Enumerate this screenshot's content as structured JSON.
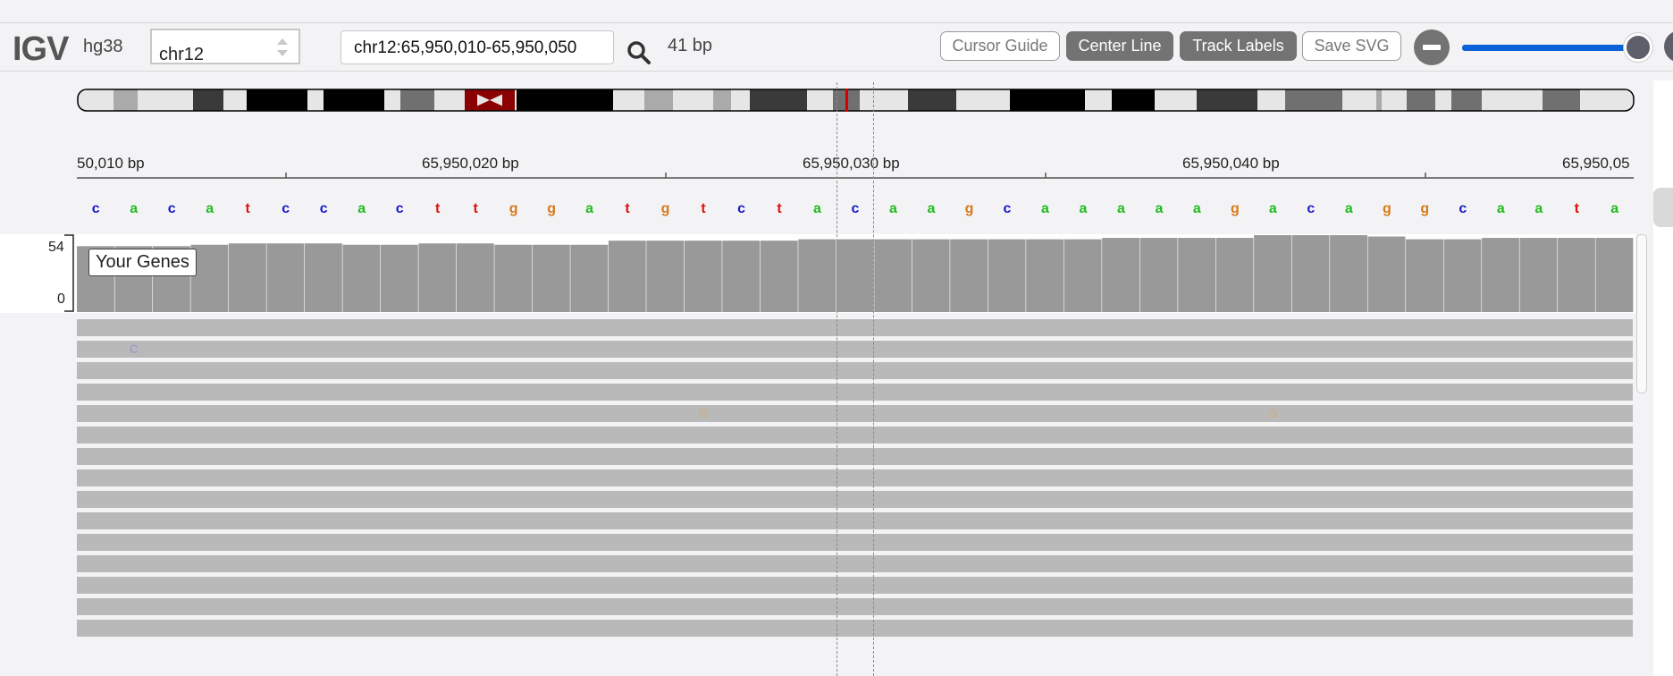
{
  "navbar": {
    "logo": "IGV",
    "genome": "hg38",
    "chromosome": "chr12",
    "locus": "chr12:65,950,010-65,950,050",
    "window_size": "41 bp",
    "buttons": {
      "cursor_guide": "Cursor Guide",
      "center_line": "Center Line",
      "track_labels": "Track Labels",
      "save_svg": "Save SVG"
    },
    "zoom_level": 1.0
  },
  "ruler": {
    "ticks": [
      "50,010 bp",
      "65,950,020 bp",
      "65,950,030 bp",
      "65,950,040 bp",
      "65,950,05"
    ]
  },
  "sequence": [
    "c",
    "a",
    "c",
    "a",
    "t",
    "c",
    "c",
    "a",
    "c",
    "t",
    "t",
    "g",
    "g",
    "a",
    "t",
    "g",
    "t",
    "c",
    "t",
    "a",
    "c",
    "a",
    "a",
    "g",
    "c",
    "a",
    "a",
    "a",
    "a",
    "a",
    "g",
    "a",
    "c",
    "a",
    "g",
    "g",
    "c",
    "a",
    "a",
    "t",
    "a"
  ],
  "base_colors": {
    "a": "#22bb22",
    "c": "#1a1acc",
    "g": "#d77a1a",
    "t": "#e01010"
  },
  "coverage": {
    "track_name": "Your Genes",
    "max": "54",
    "min": "0",
    "values": [
      48,
      48,
      48,
      49,
      50,
      50,
      50,
      49,
      49,
      50,
      50,
      49,
      49,
      49,
      52,
      52,
      52,
      52,
      52,
      53,
      53,
      53,
      53,
      53,
      53,
      53,
      53,
      54,
      54,
      54,
      54,
      56,
      56,
      56,
      55,
      53,
      53,
      54,
      54,
      54,
      54
    ]
  },
  "reads": {
    "count": 15,
    "mismatches": [
      {
        "base": "C",
        "pos": 1,
        "row": 1,
        "color": "#a0a0c8"
      },
      {
        "base": "G",
        "pos": 16,
        "row": 4,
        "color": "#c8b090"
      },
      {
        "base": "G",
        "pos": 31,
        "row": 4,
        "color": "#c8b090"
      }
    ]
  },
  "colors": {
    "accent": "#0b62d6",
    "button_active": "#737373",
    "ideogram_highlight": "#d40000",
    "centromere": "#8b0000"
  }
}
